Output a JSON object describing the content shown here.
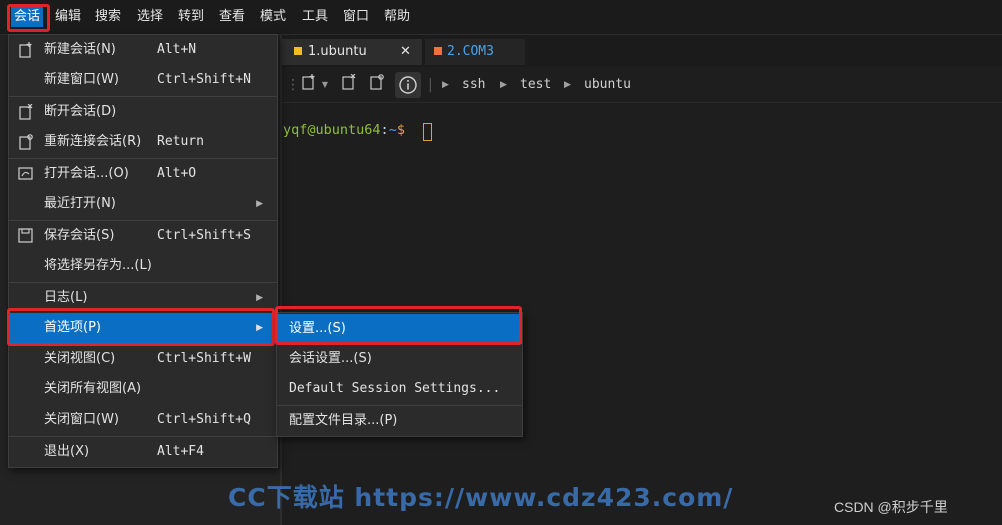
{
  "menubar": {
    "items": [
      "会话",
      "编辑",
      "搜索",
      "选择",
      "转到",
      "查看",
      "模式",
      "工具",
      "窗口",
      "帮助"
    ]
  },
  "tabs": [
    {
      "label": "1.ubuntu",
      "color": "#f0c020",
      "close": "✕"
    },
    {
      "label": "2.COM3",
      "color": "#f07040"
    }
  ],
  "breadcrumb": [
    "ssh",
    "test",
    "ubuntu"
  ],
  "terminal": {
    "user_host": "yqf@ubuntu64",
    "colon": ":",
    "path": "~",
    "prompt_symbol": "$"
  },
  "session_menu": {
    "items": [
      {
        "label": "新建会话(N)",
        "shortcut": "Alt+N",
        "icon": "new-session-icon"
      },
      {
        "label": "新建窗口(W)",
        "shortcut": "Ctrl+Shift+N"
      },
      {
        "label": "断开会话(D)",
        "shortcut": "",
        "icon": "disconnect-icon"
      },
      {
        "label": "重新连接会话(R)",
        "shortcut": "Return",
        "icon": "reconnect-icon"
      },
      {
        "label": "打开会话...(O)",
        "shortcut": "Alt+O",
        "icon": "open-session-icon"
      },
      {
        "label": "最近打开(N)",
        "shortcut": ""
      },
      {
        "label": "保存会话(S)",
        "shortcut": "Ctrl+Shift+S",
        "icon": "save-icon"
      },
      {
        "label": "将选择另存为...(L)",
        "shortcut": ""
      },
      {
        "label": "日志(L)",
        "shortcut": ""
      },
      {
        "label": "首选项(P)",
        "shortcut": ""
      },
      {
        "label": "关闭视图(C)",
        "shortcut": "Ctrl+Shift+W"
      },
      {
        "label": "关闭所有视图(A)",
        "shortcut": ""
      },
      {
        "label": "关闭窗口(W)",
        "shortcut": "Ctrl+Shift+Q"
      },
      {
        "label": "退出(X)",
        "shortcut": "Alt+F4"
      }
    ]
  },
  "preferences_submenu": {
    "items": [
      "设置...(S)",
      "会话设置...(S)",
      "Default Session Settings...",
      "配置文件目录...(P)"
    ]
  },
  "watermarks": {
    "site": "CC下载站 https://www.cdz423.com/",
    "author": "CSDN @积步千里"
  },
  "colors": {
    "accent": "#0a6fc2",
    "highlight": "#e2242a",
    "prompt_user": "#8fbf3a",
    "prompt_path": "#4aa3e8",
    "prompt_symbol": "#e0a040"
  }
}
